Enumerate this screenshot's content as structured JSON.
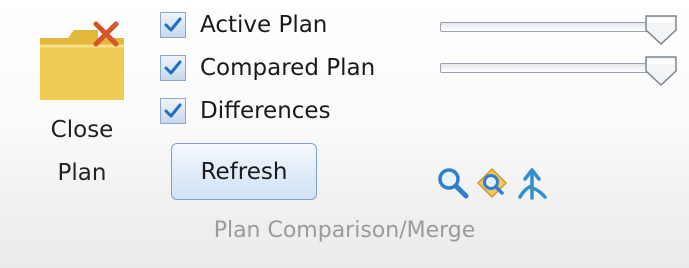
{
  "close_plan": {
    "label_line1": "Close",
    "label_line2": "Plan",
    "icon": "folder-close-icon"
  },
  "options": [
    {
      "label": "Active Plan",
      "checked": true
    },
    {
      "label": "Compared Plan",
      "checked": true
    },
    {
      "label": "Differences",
      "checked": true
    }
  ],
  "sliders": [
    {
      "for": "Active Plan",
      "level_percent": 100
    },
    {
      "for": "Compared Plan",
      "level_percent": 100
    }
  ],
  "refresh_label": "Refresh",
  "tools": [
    {
      "icon": "magnifier-icon"
    },
    {
      "icon": "tag-search-icon"
    },
    {
      "icon": "merge-arrow-icon"
    }
  ],
  "group_title": "Plan Comparison/Merge",
  "colors": {
    "accent": "#2f7fcf",
    "check_mark": "#1e6fc2",
    "folder": "#e9c44a",
    "close_x": "#d9532b",
    "caption": "#9a9a9a"
  }
}
